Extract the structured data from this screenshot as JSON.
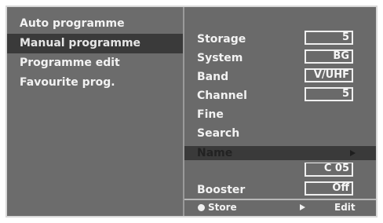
{
  "left_menu": {
    "items": [
      {
        "label": "Auto programme"
      },
      {
        "label": "Manual programme"
      },
      {
        "label": "Programme edit"
      },
      {
        "label": "Favourite prog."
      }
    ],
    "selected": "Manual programme"
  },
  "right_panel": {
    "storage": {
      "label": "Storage",
      "value": "5"
    },
    "system": {
      "label": "System",
      "value": "BG"
    },
    "band": {
      "label": "Band",
      "value": "V/UHF"
    },
    "channel": {
      "label": "Channel",
      "value": "5"
    },
    "fine": {
      "label": "Fine"
    },
    "search": {
      "label": "Search"
    },
    "name": {
      "label": "Name",
      "value": "C 05"
    },
    "booster": {
      "label": "Booster",
      "value": "Off"
    }
  },
  "footer": {
    "store_label": "Store",
    "edit_label": "Edit"
  },
  "icons": {
    "store": "circle-button-icon",
    "edit": "right-arrow-icon",
    "name_row": "right-arrow-icon"
  },
  "colors": {
    "panel_bg": "#6a6a6a",
    "selected_bg": "#3a3a3a",
    "text": "#f2f2f2",
    "frame": "#d8d8d8"
  }
}
